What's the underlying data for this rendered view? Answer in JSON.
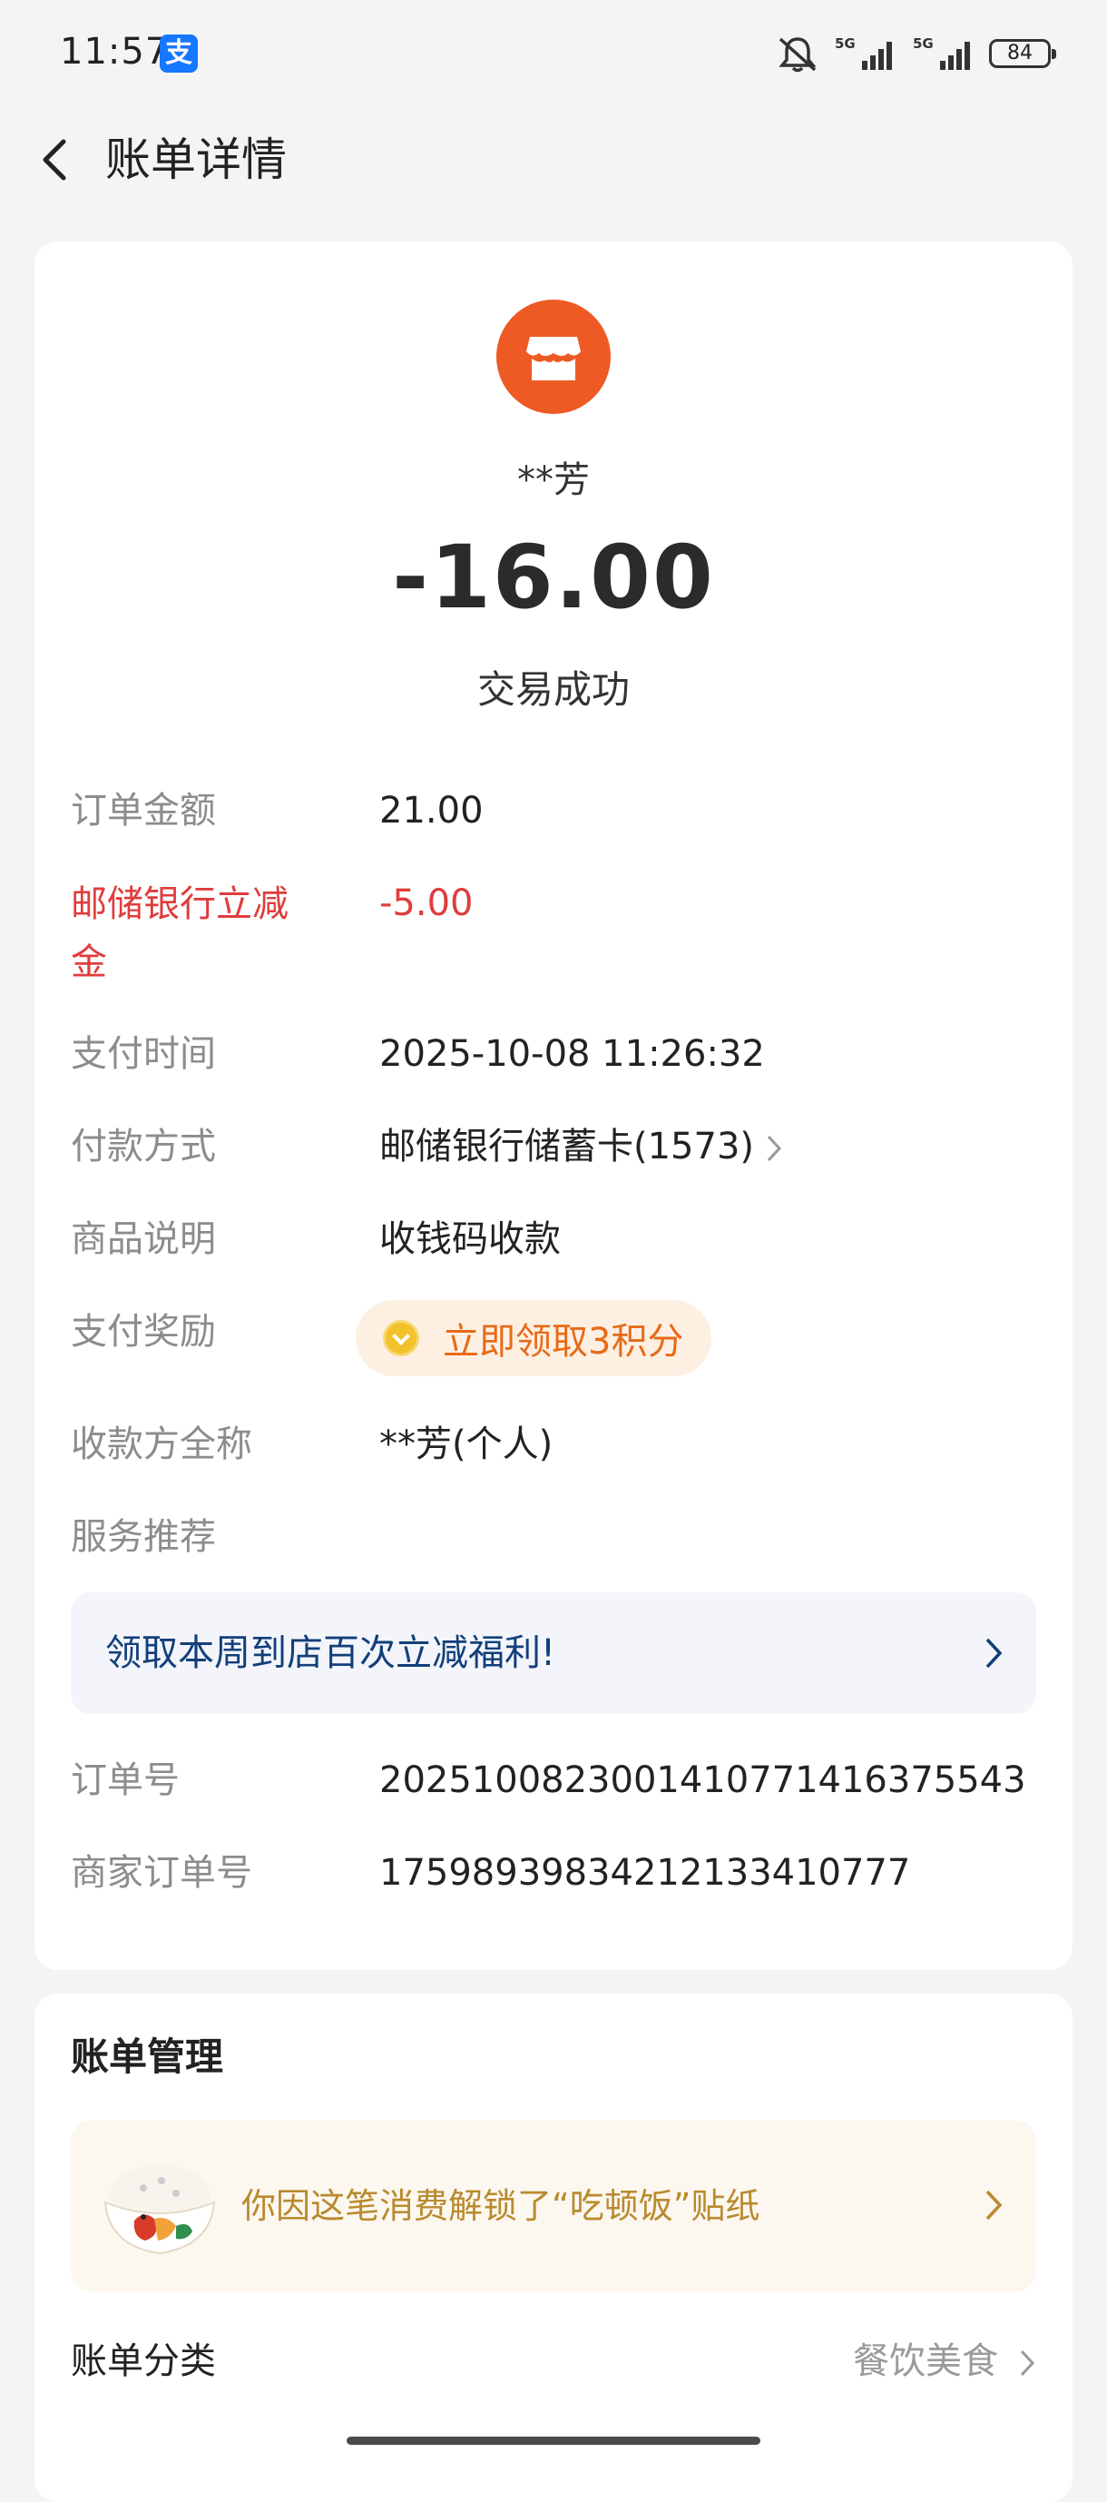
{
  "status_bar": {
    "time": "11:57",
    "app_badge": "支",
    "battery": "84",
    "icons": [
      "mute-icon",
      "signal-5g-icon",
      "signal-5g-icon",
      "battery-icon"
    ]
  },
  "header": {
    "title": "账单详情",
    "back_icon": "chevron-left-icon"
  },
  "transaction": {
    "merchant_icon": "store-icon",
    "merchant_name": "**芳",
    "amount": "-16.00",
    "status": "交易成功"
  },
  "details": {
    "order_amount": {
      "label": "订单金额",
      "value": "21.00"
    },
    "discount": {
      "label": "邮储银行立减金",
      "value": "-5.00"
    },
    "pay_time": {
      "label": "支付时间",
      "value": "2025-10-08 11:26:32"
    },
    "pay_method": {
      "label": "付款方式",
      "value": "邮储银行储蓄卡(1573)"
    },
    "goods_desc": {
      "label": "商品说明",
      "value": "收钱码收款"
    },
    "reward": {
      "label": "支付奖励",
      "value": "立即领取3积分"
    },
    "payee": {
      "label": "收款方全称",
      "value": "**芳(个人)"
    },
    "service": {
      "label": "服务推荐"
    },
    "promo": {
      "text": "领取本周到店百次立减福利!"
    },
    "order_no": {
      "label": "订单号",
      "value": "2025100823001410771416375543"
    },
    "merchant_order_no": {
      "label": "商家订单号",
      "value": "175989398342121334107​77"
    }
  },
  "manage": {
    "title": "账单管理",
    "sticker_text": "你因这笔消费解锁了“吃顿饭”贴纸",
    "category_label": "账单分类",
    "category_value": "餐饮美食"
  },
  "colors": {
    "accent_orange": "#ee5a24",
    "discount_red": "#e03c3c",
    "reward_orange": "#e86a18",
    "promo_blue": "#123f7a",
    "sticker_gold": "#b98a2e"
  }
}
